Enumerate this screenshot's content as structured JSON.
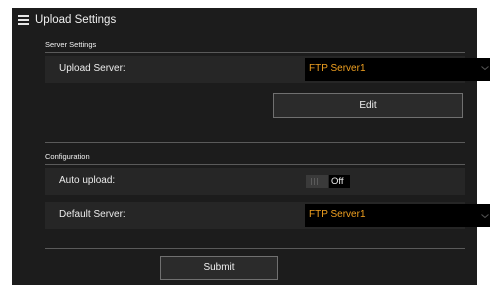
{
  "window": {
    "title": "Upload Settings",
    "menu_icon": "hamburger-menu-icon"
  },
  "server_settings": {
    "section_label": "Server Settings",
    "upload_server": {
      "label": "Upload Server:",
      "value": "FTP Server1"
    },
    "edit_label": "Edit"
  },
  "configuration": {
    "section_label": "Configuration",
    "auto_upload": {
      "label": "Auto upload:",
      "state": "Off"
    },
    "default_server": {
      "label": "Default Server:",
      "value": "FTP Server1"
    }
  },
  "submit_label": "Submit",
  "colors": {
    "background": "#1c1c1c",
    "row_background": "#262626",
    "select_background": "#000000",
    "accent_value": "#f0a020",
    "text": "#f0f0f0"
  }
}
